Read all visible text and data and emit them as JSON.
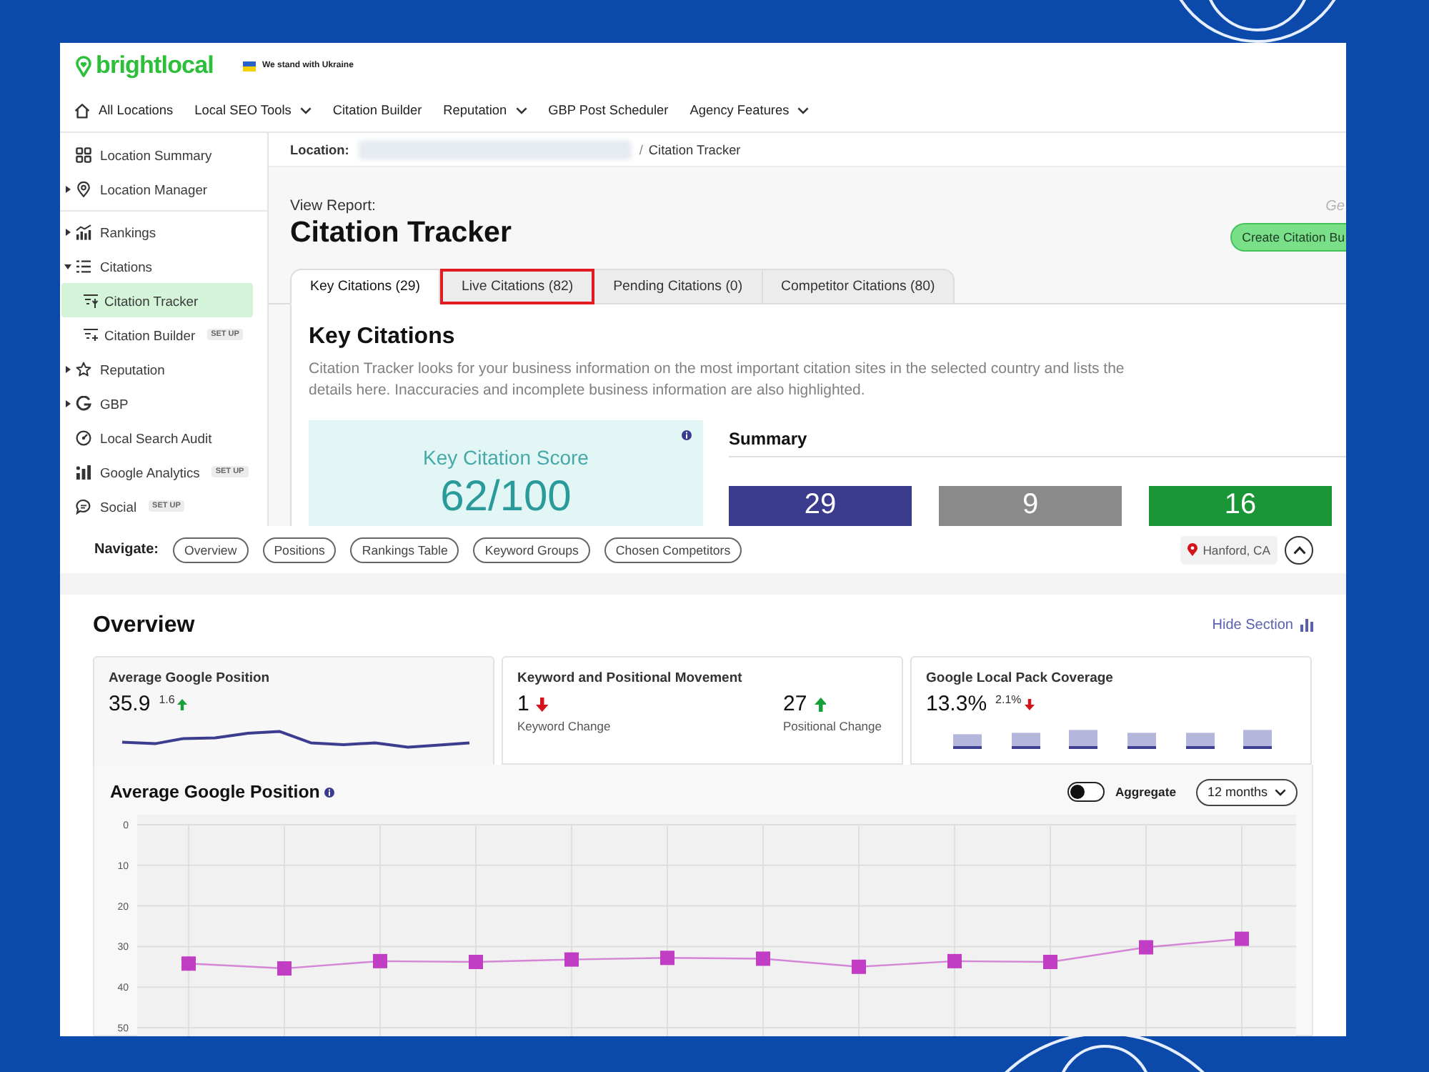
{
  "header": {
    "logo": "brightlocal",
    "banner": "We stand with Ukraine"
  },
  "nav": [
    {
      "label": "All Locations",
      "dropdown": false
    },
    {
      "label": "Local SEO Tools",
      "dropdown": true
    },
    {
      "label": "Citation Builder",
      "dropdown": false
    },
    {
      "label": "Reputation",
      "dropdown": true
    },
    {
      "label": "GBP Post Scheduler",
      "dropdown": false
    },
    {
      "label": "Agency Features",
      "dropdown": true
    }
  ],
  "sidebar": {
    "sections": [
      {
        "items": [
          {
            "label": "Location Summary",
            "selected": false
          },
          {
            "label": "Location Manager",
            "selected": false,
            "expanded": false
          }
        ]
      },
      {
        "items": [
          {
            "label": "Rankings",
            "selected": false,
            "expanded": false
          },
          {
            "label": "Citations",
            "selected": false,
            "expanded": true,
            "children": [
              {
                "label": "Citation Tracker",
                "selected": true
              },
              {
                "label": "Citation Builder",
                "selected": false,
                "badge": "SET UP"
              }
            ]
          },
          {
            "label": "Reputation",
            "selected": false,
            "expanded": false
          },
          {
            "label": "GBP",
            "selected": false,
            "expanded": false
          },
          {
            "label": "Local Search Audit",
            "selected": false
          },
          {
            "label": "Google Analytics",
            "selected": false,
            "badge": "SET UP"
          },
          {
            "label": "Social",
            "selected": false,
            "badge": "SET UP"
          }
        ]
      }
    ]
  },
  "breadcrumb": {
    "label": "Location:",
    "separator": "/",
    "current": "Citation Tracker"
  },
  "report": {
    "eyebrow": "View Report:",
    "title": "Citation Tracker",
    "corner_text": "Ge",
    "button": "Create Citation Bu"
  },
  "tabs": [
    {
      "label": "Key Citations (29)",
      "selected": true,
      "highlighted": false
    },
    {
      "label": "Live Citations (82)",
      "selected": false,
      "highlighted": true
    },
    {
      "label": "Pending Citations (0)",
      "selected": false,
      "highlighted": false
    },
    {
      "label": "Competitor Citations (80)",
      "selected": false,
      "highlighted": false
    }
  ],
  "key_citations": {
    "heading": "Key Citations",
    "description": "Citation Tracker looks for your business information on the most important citation sites in the selected country and lists the details here. Inaccuracies and incomplete business information are also highlighted.",
    "score": {
      "label": "Key Citation Score",
      "value": "62/100"
    },
    "summary": {
      "title": "Summary",
      "tiles": [
        {
          "value": "29",
          "color": "#3b3b8e"
        },
        {
          "value": "9",
          "color": "#8a8a8a"
        },
        {
          "value": "16",
          "color": "#1a9636"
        }
      ]
    }
  },
  "navigate": {
    "label": "Navigate:",
    "links": [
      "Overview",
      "Positions",
      "Rankings Table",
      "Keyword Groups",
      "Chosen Competitors"
    ],
    "location": "Hanford, CA"
  },
  "overview": {
    "title": "Overview",
    "hide_link": "Hide Section",
    "cards": [
      {
        "kind": "sparkline",
        "title": "Average Google Position",
        "selected": true,
        "value": "35.9",
        "change": "1.6",
        "rising": true
      },
      {
        "kind": "movement",
        "title": "Keyword and Positional Movement",
        "selected": false,
        "metrics": [
          {
            "value": "1",
            "rising": false,
            "caption": "Keyword Change"
          },
          {
            "value": "27",
            "rising": true,
            "caption": "Positional Change"
          }
        ]
      },
      {
        "kind": "bars",
        "title": "Google Local Pack Coverage",
        "selected": false,
        "value": "13.3%",
        "change": "2.1%",
        "rising": false
      }
    ],
    "chart_panel": {
      "title": "Average Google Position",
      "toggle": {
        "label": "Aggregate",
        "on": false
      },
      "range": "12 months",
      "chart_data": {
        "type": "line",
        "grid": true,
        "ylim": [
          50,
          0
        ],
        "yticks": [
          0,
          10,
          20,
          30,
          40,
          50
        ],
        "series": [
          {
            "color": "#c13dc4",
            "marker": "square",
            "values": [
              34.2,
              35.4,
              33.6,
              33.8,
              33.2,
              32.8,
              33.0,
              35.0,
              33.6,
              33.8,
              30.2,
              28.1
            ]
          }
        ]
      }
    }
  }
}
